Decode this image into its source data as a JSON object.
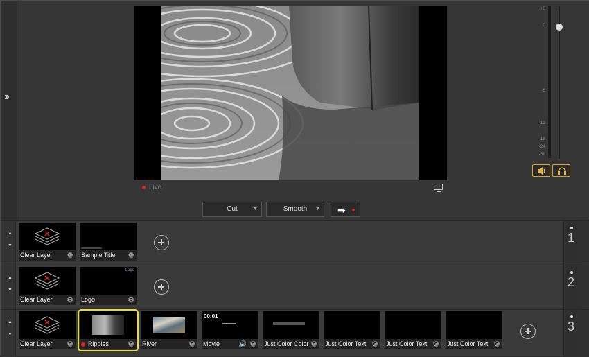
{
  "preview": {
    "live_label": "Live",
    "icons": {
      "monitor": "monitor-icon",
      "expand": "double-chevron-right-icon"
    }
  },
  "transition": {
    "cut_label": "Cut",
    "smooth_label": "Smooth",
    "take_icon": "arrow-right-icon"
  },
  "audio": {
    "scale": [
      "+6",
      "0",
      "-6",
      "-12",
      "-18",
      "-24",
      "-36"
    ],
    "volume_icon": "speaker-icon",
    "headphones_icon": "headphones-icon",
    "accent": "#d9a62a"
  },
  "layers": [
    {
      "number": "1",
      "clips": [
        {
          "label": "Clear Layer",
          "kind": "clear"
        },
        {
          "label": "Sample Title",
          "kind": "title"
        }
      ]
    },
    {
      "number": "2",
      "clips": [
        {
          "label": "Clear Layer",
          "kind": "clear"
        },
        {
          "label": "Logo",
          "kind": "logo",
          "thumb_text": "Logo"
        }
      ]
    },
    {
      "number": "3",
      "clips": [
        {
          "label": "Clear Layer",
          "kind": "clear"
        },
        {
          "label": "Ripples",
          "kind": "video",
          "live": true,
          "selected": true
        },
        {
          "label": "River",
          "kind": "video"
        },
        {
          "label": "Movie",
          "kind": "movie",
          "time": "00:01"
        },
        {
          "label": "Just Color Color",
          "kind": "color"
        },
        {
          "label": "Just Color Text",
          "kind": "color"
        },
        {
          "label": "Just Color Text",
          "kind": "color"
        },
        {
          "label": "Just Color Text",
          "kind": "color"
        }
      ]
    }
  ],
  "colors": {
    "live_dot": "#dd2222",
    "selection": "#e8d84a"
  }
}
